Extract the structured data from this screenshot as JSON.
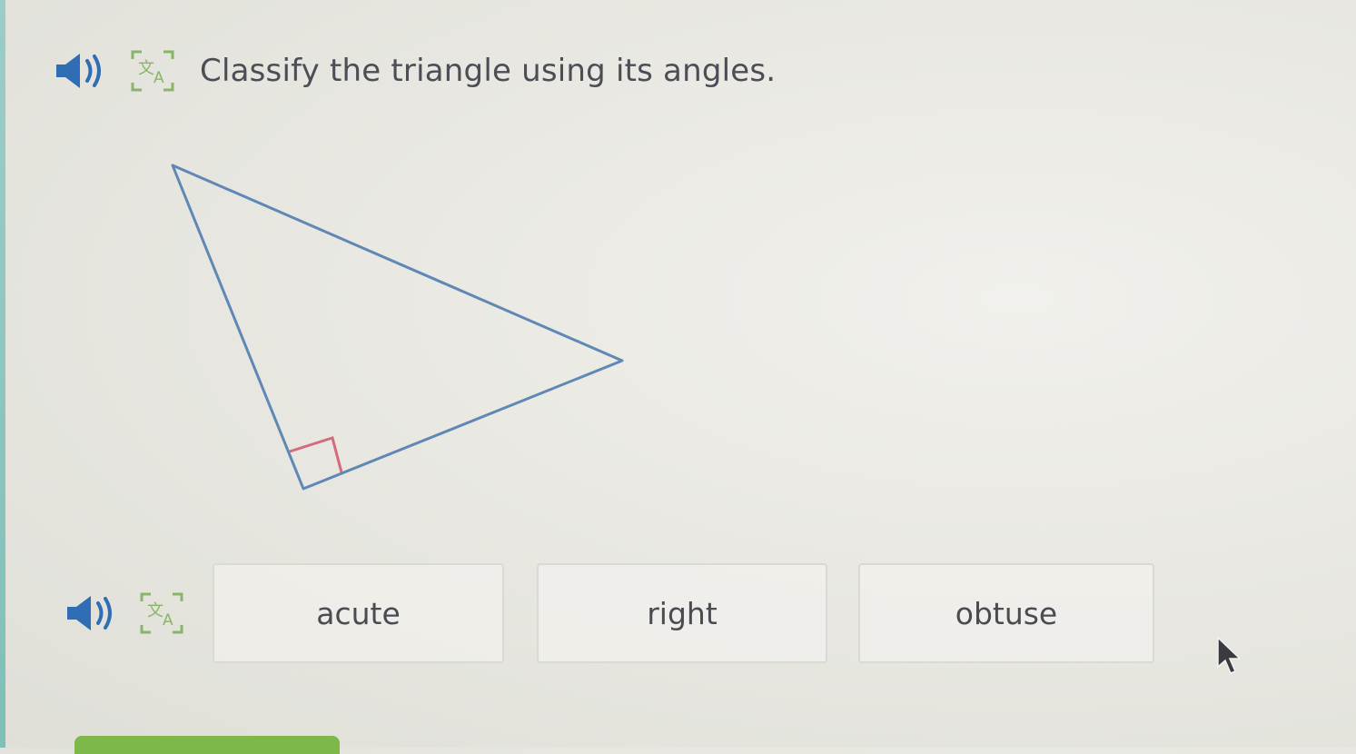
{
  "question": {
    "text": "Classify the triangle using its angles."
  },
  "choices": [
    {
      "label": "acute"
    },
    {
      "label": "right"
    },
    {
      "label": "obtuse"
    }
  ],
  "colors": {
    "triangle_stroke": "#5f88b5",
    "right_angle_marker": "#d46a7d",
    "speaker_icon": "#2f6db5",
    "submit_button": "#7fb84a"
  },
  "icons": {
    "audio": "speaker-icon",
    "translate": "translate-icon"
  }
}
